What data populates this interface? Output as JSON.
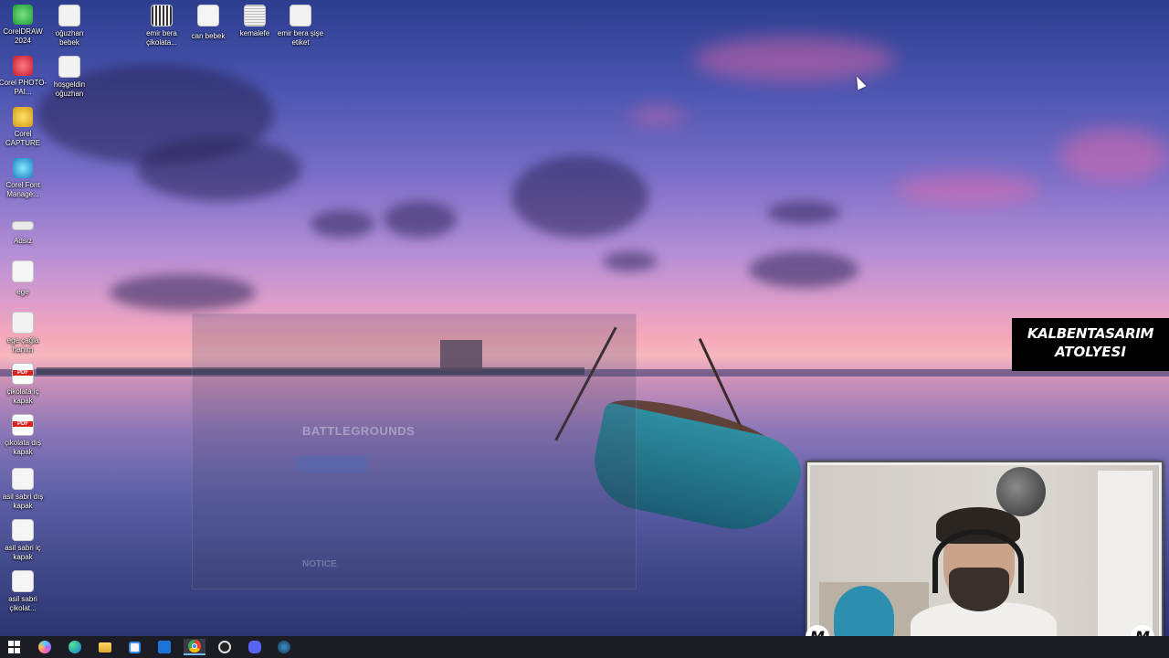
{
  "desktop": {
    "icons_left": [
      {
        "label": "CorelDRAW 2024",
        "icon": "coreldraw-icon"
      },
      {
        "label": "Corel PHOTO-PAI...",
        "icon": "corel-photo-paint-icon"
      },
      {
        "label": "Corel CAPTURE",
        "icon": "corel-capture-icon"
      },
      {
        "label": "Corel Font Manage...",
        "icon": "corel-font-manager-icon"
      },
      {
        "label": "Adsız",
        "icon": "file-icon"
      },
      {
        "label": "ege",
        "icon": "file-icon"
      },
      {
        "label": "ege çağla hanım",
        "icon": "document-icon"
      },
      {
        "label": "çikolata iç kapak",
        "icon": "pdf-icon"
      },
      {
        "label": "çikolata dış kapak",
        "icon": "pdf-icon"
      },
      {
        "label": "asil sabri dış kapak",
        "icon": "image-file-icon"
      },
      {
        "label": "asil sabri iç kapak",
        "icon": "image-file-icon"
      },
      {
        "label": "asil sabri çikolat...",
        "icon": "image-file-icon"
      }
    ],
    "icons_col2": [
      {
        "label": "oğuzhan bebek",
        "icon": "document-icon"
      },
      {
        "label": "hoşgeldin oğuzhan",
        "icon": "document-icon"
      }
    ],
    "icons_top": [
      {
        "label": "emir bera çikolata...",
        "icon": "document-icon"
      },
      {
        "label": "can bebek",
        "icon": "image-file-icon"
      },
      {
        "label": "kemalefe",
        "icon": "document-icon"
      },
      {
        "label": "emir bera şişe etiket",
        "icon": "document-icon"
      }
    ],
    "pdf_badge": "PDF"
  },
  "ghost_window": {
    "title": "BATTLEGROUNDS",
    "subtitle": "NOTICE"
  },
  "logo_banner": {
    "line1": "KALBENTASARIM",
    "line2": "ATOLYESI"
  },
  "webcam": {
    "badge_letter": "M"
  },
  "taskbar": {
    "items": [
      {
        "name": "start-button",
        "icon": "windows-icon"
      },
      {
        "name": "copilot-button",
        "icon": "copilot-icon"
      },
      {
        "name": "edge-button",
        "icon": "edge-icon"
      },
      {
        "name": "file-explorer-button",
        "icon": "folder-icon"
      },
      {
        "name": "store-button",
        "icon": "store-icon"
      },
      {
        "name": "mail-button",
        "icon": "mail-icon"
      },
      {
        "name": "chrome-button",
        "icon": "chrome-icon",
        "active": true
      },
      {
        "name": "obs-button",
        "icon": "obs-icon"
      },
      {
        "name": "discord-button",
        "icon": "discord-icon"
      },
      {
        "name": "steam-button",
        "icon": "steam-icon"
      }
    ]
  },
  "colors": {
    "taskbar_bg": "#1c1c24",
    "active_indicator": "#76b9ed"
  }
}
